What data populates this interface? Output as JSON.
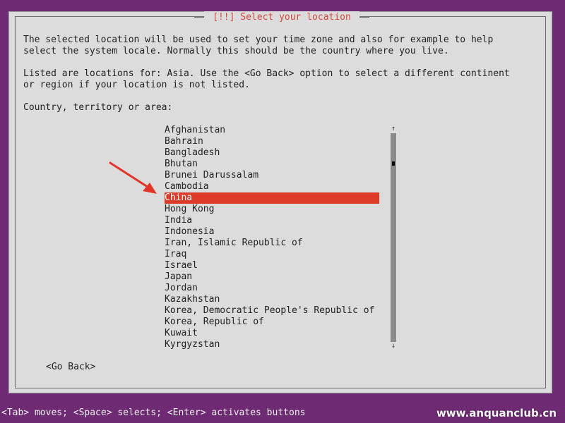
{
  "title": "[!!] Select your location",
  "description": {
    "para1": "The selected location will be used to set your time zone and also for example to help\nselect the system locale. Normally this should be the country where you live.",
    "para2": "Listed are locations for: Asia. Use the <Go Back> option to select a different continent\nor region if your location is not listed.",
    "prompt": "Country, territory or area:"
  },
  "list": {
    "items": [
      "Afghanistan",
      "Bahrain",
      "Bangladesh",
      "Bhutan",
      "Brunei Darussalam",
      "Cambodia",
      "China",
      "Hong Kong",
      "India",
      "Indonesia",
      "Iran, Islamic Republic of",
      "Iraq",
      "Israel",
      "Japan",
      "Jordan",
      "Kazakhstan",
      "Korea, Democratic People's Republic of",
      "Korea, Republic of",
      "Kuwait",
      "Kyrgyzstan"
    ],
    "selected_index": 6
  },
  "scrollbar": {
    "up_arrow": "↑",
    "down_arrow": "↓"
  },
  "buttons": {
    "go_back": "<Go Back>"
  },
  "status_bar": {
    "text": "<Tab> moves; <Space> selects; <Enter> activates buttons",
    "watermark": "www.anquanclub.cn"
  },
  "colors": {
    "background": "#6e2b73",
    "dialog": "#dcdcdc",
    "accent": "#dd3b2a",
    "title": "#d24a3b"
  },
  "icons": {
    "annotation_arrow": "red-arrow-icon"
  }
}
